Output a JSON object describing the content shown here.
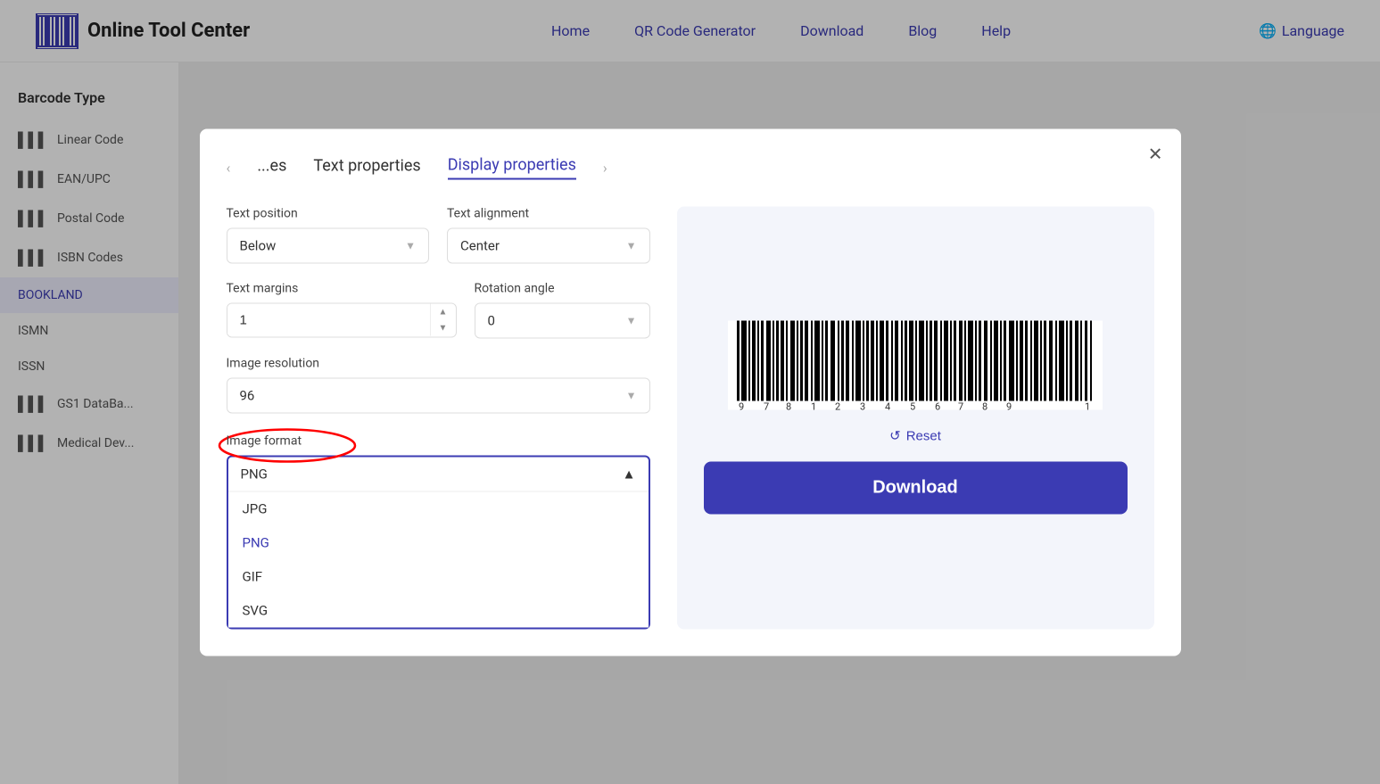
{
  "header": {
    "logo_text": "Online Tool Center",
    "nav": [
      {
        "label": "Home",
        "id": "home"
      },
      {
        "label": "QR Code Generator",
        "id": "qr-code"
      },
      {
        "label": "Download",
        "id": "download"
      },
      {
        "label": "Blog",
        "id": "blog"
      },
      {
        "label": "Help",
        "id": "help"
      }
    ],
    "language_label": "Language"
  },
  "sidebar": {
    "title": "Barcode Type",
    "items": [
      {
        "label": "Linear Code",
        "id": "linear",
        "icon": "▌▌▌"
      },
      {
        "label": "EAN/UPC",
        "id": "ean",
        "icon": "▌▌▌"
      },
      {
        "label": "Postal Code",
        "id": "postal",
        "icon": "▌▌▌"
      },
      {
        "label": "ISBN Codes",
        "id": "isbn",
        "icon": "▌▌▌"
      },
      {
        "label": "BOOKLAND",
        "id": "bookland",
        "active": true
      },
      {
        "label": "ISMN",
        "id": "ismn"
      },
      {
        "label": "ISSN",
        "id": "issn"
      },
      {
        "label": "GS1 DataBa...",
        "id": "gs1",
        "icon": "▌▌▌"
      },
      {
        "label": "Medical Dev...",
        "id": "medical",
        "icon": "▌▌▌"
      }
    ]
  },
  "modal": {
    "tabs": [
      {
        "label": "...es",
        "id": "tab1"
      },
      {
        "label": "Text properties",
        "id": "tab2"
      },
      {
        "label": "Display properties",
        "id": "tab3",
        "active": true
      }
    ],
    "close_label": "✕",
    "form": {
      "text_position_label": "Text position",
      "text_position_value": "Below",
      "text_alignment_label": "Text alignment",
      "text_alignment_value": "Center",
      "text_margins_label": "Text margins",
      "text_margins_value": "1",
      "rotation_angle_label": "Rotation angle",
      "rotation_angle_value": "0",
      "image_resolution_label": "Image resolution",
      "image_resolution_value": "96",
      "image_format_label": "Image format",
      "image_format_value": "PNG",
      "format_options": [
        {
          "label": "JPG",
          "value": "jpg"
        },
        {
          "label": "PNG",
          "value": "png",
          "selected": true
        },
        {
          "label": "GIF",
          "value": "gif"
        },
        {
          "label": "SVG",
          "value": "svg"
        }
      ]
    },
    "reset_label": "Reset",
    "download_label": "Download",
    "barcode_numbers": "9 7 8 1 2 3 4 5 6 7 8 9 1"
  }
}
